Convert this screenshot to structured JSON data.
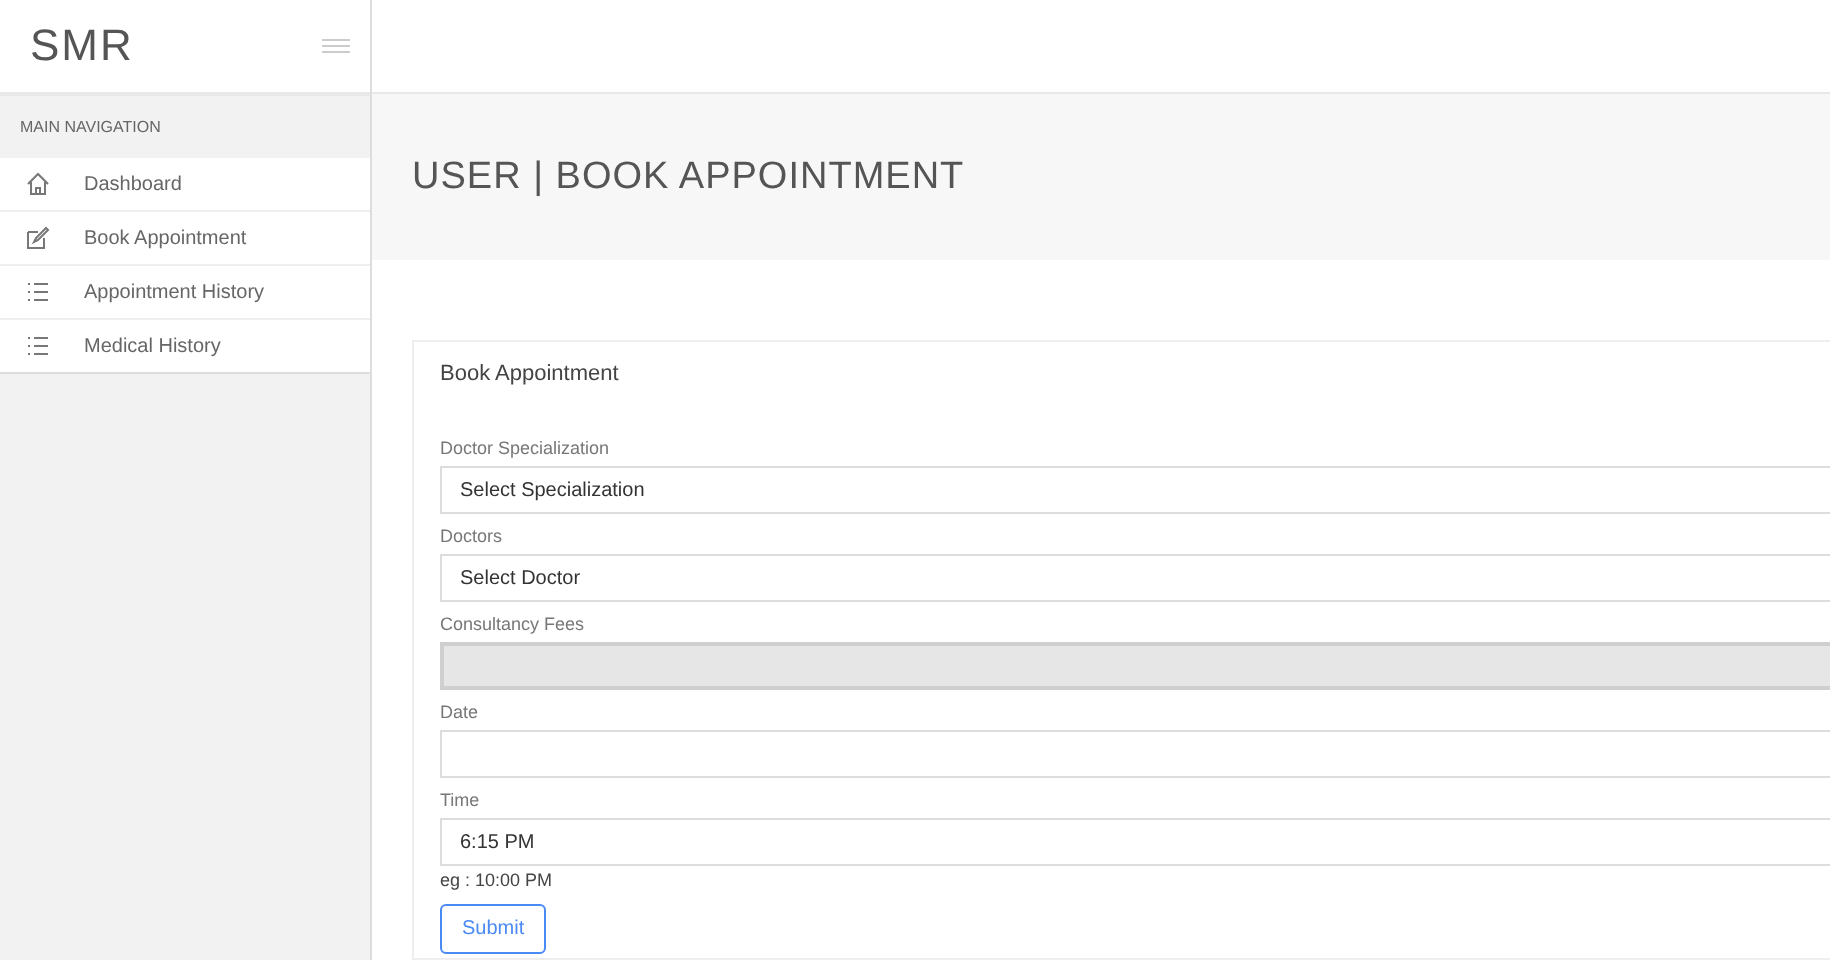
{
  "brand": "SMR",
  "sidebar": {
    "heading": "MAIN NAVIGATION",
    "items": [
      {
        "label": "Dashboard"
      },
      {
        "label": "Book Appointment"
      },
      {
        "label": "Appointment History"
      },
      {
        "label": "Medical History"
      }
    ]
  },
  "page_title": "USER | BOOK APPOINTMENT",
  "form": {
    "title": "Book Appointment",
    "fields": [
      {
        "label": "Doctor Specialization",
        "value": "Select Specialization",
        "disabled": false
      },
      {
        "label": "Doctors",
        "value": "Select Doctor",
        "disabled": false
      },
      {
        "label": "Consultancy Fees",
        "disabled": true
      },
      {
        "label": "Date",
        "disabled": false
      },
      {
        "label": "Time",
        "value": "6:15 PM",
        "hint": "eg : 10:00 PM",
        "disabled": false
      }
    ],
    "submit": "Submit"
  }
}
